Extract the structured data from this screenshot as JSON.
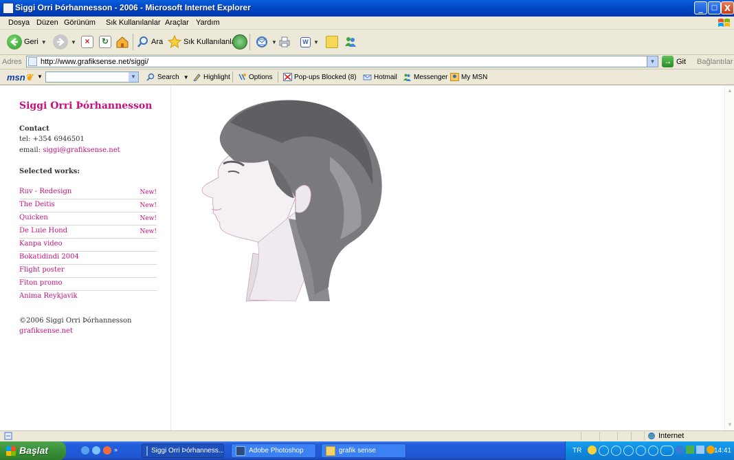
{
  "window": {
    "title": "Siggi Orri Þórhannesson - 2006 - Microsoft Internet Explorer",
    "min": "_",
    "max": "□",
    "close": "X"
  },
  "menu": [
    "Dosya",
    "Düzen",
    "Görünüm",
    "Sık Kullanılanlar",
    "Araçlar",
    "Yardım"
  ],
  "toolbar": {
    "back": "Geri",
    "search": "Ara",
    "favorites": "Sık Kullanılanlar"
  },
  "address": {
    "label": "Adres",
    "url": "http://www.grafiksense.net/siggi/",
    "go": "Git",
    "links": "Bağlantılar"
  },
  "msnbar": {
    "logo": "msn",
    "search": "Search",
    "highlight": "Highlight",
    "options": "Options",
    "popups": "Pop-ups Blocked (8)",
    "hotmail": "Hotmail",
    "messenger": "Messenger",
    "mymsn": "My MSN"
  },
  "page": {
    "site_title": "Siggi Orri Þórhannesson",
    "contact_heading": "Contact",
    "tel": "tel: +354 6946501",
    "email_label": "email:",
    "email": "siggi@grafiksense.net",
    "works_heading": "Selected works:",
    "works": [
      {
        "label": "Ruv - Redesign",
        "badge": "New!"
      },
      {
        "label": "The Deitis",
        "badge": "New!"
      },
      {
        "label": "Quicken",
        "badge": "New!"
      },
      {
        "label": "De Luie Hond",
        "badge": "New!"
      },
      {
        "label": "Kanpa video",
        "badge": ""
      },
      {
        "label": "Bokatidindi 2004",
        "badge": ""
      },
      {
        "label": "Flight poster",
        "badge": ""
      },
      {
        "label": "Fiton promo",
        "badge": ""
      },
      {
        "label": "Anima Reykjavik",
        "badge": ""
      }
    ],
    "copyright": "©2006 Siggi Orri Þórhannesson",
    "site_link": "grafiksense.net"
  },
  "status": {
    "zone": "Internet"
  },
  "taskbar": {
    "start": "Başlat",
    "tasks": [
      "Siggi Orri Þórhanness...",
      "Adobe Photoshop",
      "grafik sense"
    ],
    "lang": "TR",
    "clock": "14:41"
  }
}
